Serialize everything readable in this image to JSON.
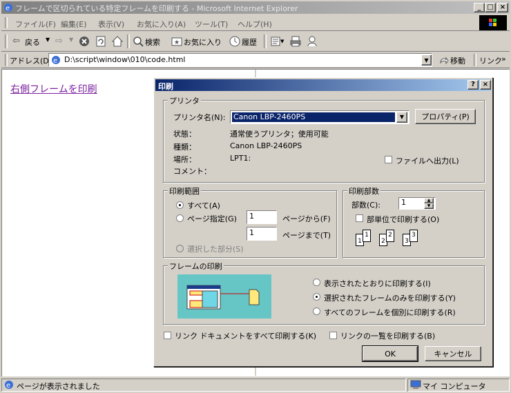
{
  "window": {
    "title": "フレームで区切られている特定フレームを印刷する - Microsoft Internet Explorer"
  },
  "menu": [
    "ファイル(F)",
    "編集(E)",
    "表示(V)",
    "お気に入り(A)",
    "ツール(T)",
    "ヘルプ(H)"
  ],
  "toolbar": {
    "back": "戻る",
    "search": "検索",
    "favorites": "お気に入り",
    "history": "履歴"
  },
  "address": {
    "label": "アドレス(D)",
    "value": "D:\\script\\window\\010\\code.html",
    "go": "移動",
    "links": "リンク"
  },
  "page": {
    "link_text": "右側フレームを印刷"
  },
  "status": {
    "text": "ページが表示されました",
    "zone": "マイ コンピュータ"
  },
  "dialog": {
    "title": "印刷",
    "help_button": "?",
    "close_button": "×",
    "printer": {
      "legend": "プリンタ",
      "name_label": "プリンタ名(N):",
      "selected": "Canon LBP-2460PS",
      "properties_button": "プロパティ(P)",
      "status_label": "状態：",
      "status_value": "通常使うプリンタ；使用可能",
      "type_label": "種類：",
      "type_value": "Canon LBP-2460PS",
      "where_label": "場所：",
      "where_value": "LPT1:",
      "comment_label": "コメント：",
      "print_to_file": "ファイルへ出力(L)"
    },
    "range": {
      "legend": "印刷範囲",
      "all": "すべて(A)",
      "pages": "ページ指定(G)",
      "from_value": "1",
      "from_label": "ページから(F)",
      "to_value": "1",
      "to_label": "ページまで(T)",
      "selection": "選択した部分(S)",
      "selected_option": "all"
    },
    "copies": {
      "legend": "印刷部数",
      "count_label": "部数(C):",
      "count_value": "1",
      "collate": "部単位で印刷する(O)",
      "collate_icons": [
        "1",
        "1",
        "2",
        "2",
        "3",
        "3"
      ]
    },
    "frames": {
      "legend": "フレームの印刷",
      "as_laid_out": "表示されたとおりに印刷する(I)",
      "selected_frame": "選択されたフレームのみを印刷する(Y)",
      "each_frame": "すべてのフレームを個別に印刷する(R)",
      "selected_option": "selected_frame"
    },
    "print_links": "リンク ドキュメントをすべて印刷する(K)",
    "print_link_table": "リンクの一覧を印刷する(B)",
    "ok": "OK",
    "cancel": "キャンセル"
  }
}
